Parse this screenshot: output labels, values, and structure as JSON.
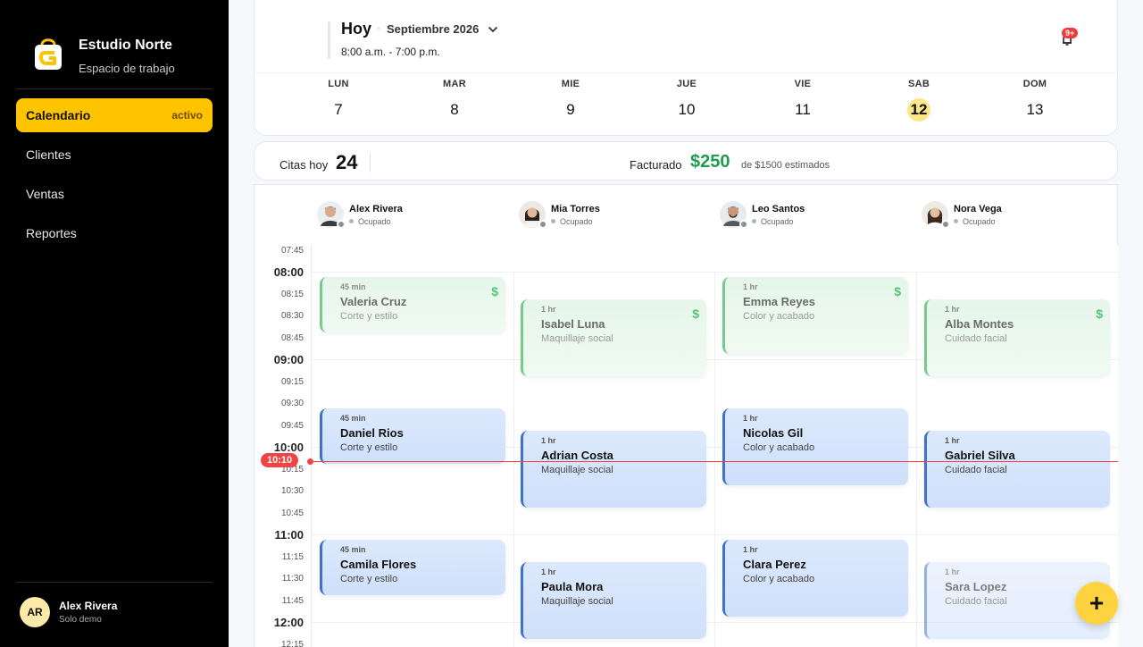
{
  "sidebar": {
    "brand_name": "Estudio Norte",
    "brand_sub": "Espacio de trabajo",
    "nav": [
      {
        "label": "Calendario",
        "badge": "activo"
      },
      {
        "label": "Clientes"
      },
      {
        "label": "Ventas"
      },
      {
        "label": "Reportes"
      }
    ],
    "user": {
      "initials": "AR",
      "name": "Alex Rivera",
      "sub": "Solo demo"
    }
  },
  "header": {
    "title": "Hoy",
    "separator": "·",
    "month": "Septiembre 2026",
    "hours": "8:00 a.m. - 7:00 p.m.",
    "notif_badge": "9+",
    "days": [
      {
        "name": "LUN",
        "num": "7"
      },
      {
        "name": "MAR",
        "num": "8"
      },
      {
        "name": "MIE",
        "num": "9"
      },
      {
        "name": "JUE",
        "num": "10"
      },
      {
        "name": "VIE",
        "num": "11"
      },
      {
        "name": "SAB",
        "num": "12",
        "selected": true
      },
      {
        "name": "DOM",
        "num": "13"
      }
    ]
  },
  "stats": {
    "citas_label": "Citas hoy",
    "citas_value": "24",
    "fact_label": "Facturado",
    "fact_value": "$250",
    "fact_note": "de $1500 estimados"
  },
  "staff": [
    {
      "name": "Alex Rivera",
      "status": "Ocupado"
    },
    {
      "name": "Mia Torres",
      "status": "Ocupado"
    },
    {
      "name": "Leo Santos",
      "status": "Ocupado"
    },
    {
      "name": "Nora Vega",
      "status": "Ocupado"
    }
  ],
  "times": [
    "07:45",
    "08:00",
    "08:15",
    "08:30",
    "08:45",
    "09:00",
    "09:15",
    "09:30",
    "09:45",
    "10:00",
    "10:15",
    "10:30",
    "10:45",
    "11:00",
    "11:15",
    "11:30",
    "11:45",
    "12:00",
    "12:15"
  ],
  "now_label": "10:10",
  "appointments": {
    "col0": [
      {
        "dur": "45 min",
        "name": "Valeria Cruz",
        "svc": "Corte y estilo",
        "paid": true
      },
      {
        "dur": "45 min",
        "name": "Daniel Rios",
        "svc": "Corte y estilo"
      },
      {
        "dur": "45 min",
        "name": "Camila Flores",
        "svc": "Corte y estilo"
      }
    ],
    "col1": [
      {
        "dur": "1 hr",
        "name": "Isabel Luna",
        "svc": "Maquillaje social",
        "paid": true
      },
      {
        "dur": "1 hr",
        "name": "Adrian Costa",
        "svc": "Maquillaje social"
      },
      {
        "dur": "1 hr",
        "name": "Paula Mora",
        "svc": "Maquillaje social"
      }
    ],
    "col2": [
      {
        "dur": "1 hr",
        "name": "Emma Reyes",
        "svc": "Color y acabado",
        "paid": true
      },
      {
        "dur": "1 hr",
        "name": "Nicolas Gil",
        "svc": "Color y acabado"
      },
      {
        "dur": "1 hr",
        "name": "Clara Perez",
        "svc": "Color y acabado"
      }
    ],
    "col3": [
      {
        "dur": "1 hr",
        "name": "Alba Montes",
        "svc": "Cuidado facial",
        "paid": true
      },
      {
        "dur": "1 hr",
        "name": "Gabriel Silva",
        "svc": "Cuidado facial"
      },
      {
        "dur": "1 hr",
        "name": "Sara Lopez",
        "svc": "Cuidado facial"
      }
    ]
  },
  "paid_symbol": "$",
  "fab_label": "+",
  "colors": {
    "accent": "#ffc400",
    "money": "#1f9d4f",
    "now": "#f04343",
    "appt_blue": "#3f72c8",
    "appt_green": "#79c98d"
  }
}
